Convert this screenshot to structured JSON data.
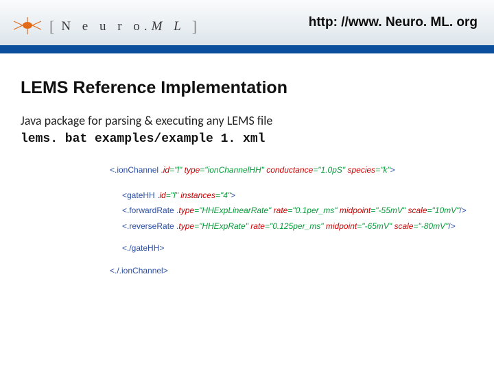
{
  "header": {
    "logo_text_1": "N e u r o.",
    "logo_text_2": "M L",
    "url": "http: //www. Neuro. ML. org"
  },
  "title": "LEMS Reference Implementation",
  "subtitle": "Java package for parsing & executing any LEMS file",
  "command": "lems. bat examples/example 1. xml",
  "code": {
    "l1": {
      "open": "<.ionChannel .",
      "a1n": "id",
      "a1v": "=\"l\"",
      "a2n": " type",
      "a2v": "=\"ionChannelHH\"",
      "a3n": " conductance",
      "a3v": "=\"1.0pS\"",
      "a4n": " species",
      "a4v": "=\"k\"",
      "close": ">"
    },
    "l2": {
      "open": "<gateHH .",
      "a1n": "id",
      "a1v": "=\"l\"",
      "a2n": " instances",
      "a2v": "=\"4\"",
      "close": ">"
    },
    "l3": {
      "open": "<.forwardRate .",
      "a1n": "type",
      "a1v": "=\"HHExpLinearRate\"",
      "a2n": " rate",
      "a2v": "=\"0.1per_ms\"",
      "a3n": " midpoint",
      "a3v": "=\"-55mV\"",
      "a4n": " scale",
      "a4v": "=\"10mV\"",
      "close": "/>"
    },
    "l4": {
      "open": "<.reverseRate .",
      "a1n": "type",
      "a1v": "=\"HHExpRate\"",
      "a2n": " rate",
      "a2v": "=\"0.125per_ms\"",
      "a3n": " midpoint",
      "a3v": "=\"-65mV\"",
      "a4n": " scale",
      "a4v": "=\"-80mV\"",
      "close": "/>"
    },
    "l5": "<./gateHH>",
    "l6": "<./.ionChannel>"
  }
}
